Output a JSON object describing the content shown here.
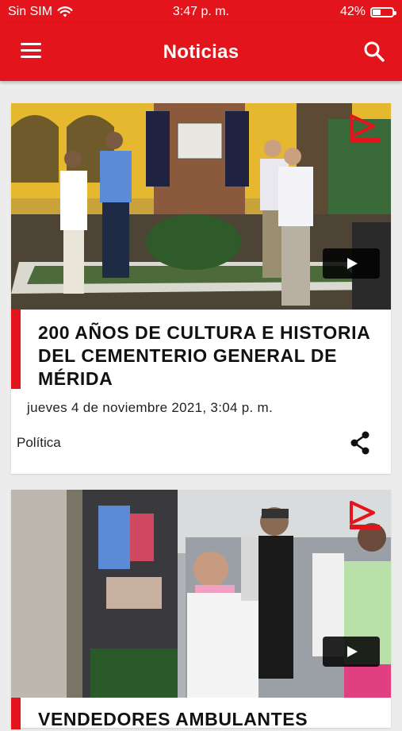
{
  "status_bar": {
    "carrier": "Sin SIM",
    "time": "3:47 p. m.",
    "battery_text": "42%",
    "battery_level": 0.42
  },
  "header": {
    "title": "Noticias",
    "menu_icon": "hamburger-menu-icon",
    "search_icon": "search-icon"
  },
  "articles": [
    {
      "headline": "200 AÑOS DE CULTURA E HISTORIA DEL CEMENTERIO GENERAL DE MÉRIDA",
      "date": "jueves 4 de noviembre 2021, 3:04 p. m.",
      "category": "Política",
      "has_video": true
    },
    {
      "headline": "VENDEDORES AMBULANTES",
      "has_video": true
    }
  ],
  "colors": {
    "brand_red": "#e3141b",
    "background": "#ececec",
    "card": "#ffffff"
  }
}
